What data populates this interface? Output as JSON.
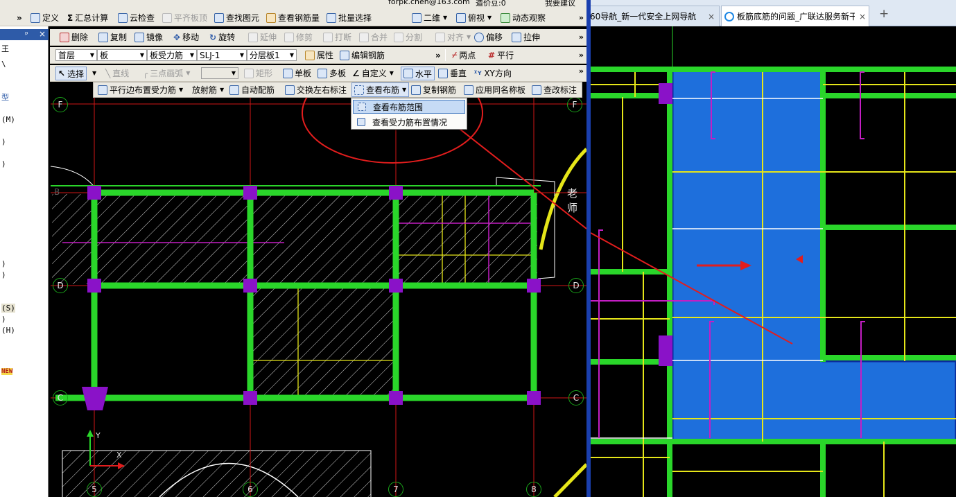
{
  "toolbar1": {
    "overflow_left": "»",
    "define": "定义",
    "sum_calc": "汇总计算",
    "cloud_check": "云检查",
    "align_top": "平齐板顶",
    "find_elem": "查找图元",
    "view_rebar_qty": "查看钢筋量",
    "batch_select": "批量选择",
    "two_d": "二维",
    "top_view": "俯视",
    "dyn_observe": "动态观察",
    "overflow": "»",
    "account": "forpk.chen@163.com",
    "price_bean": "造价豆:0",
    "suggest": "我要建议"
  },
  "left_panel": {
    "pin": "ᵖ",
    "close": "×",
    "rows": [
      "王",
      "\\",
      "型",
      "(M)",
      ")",
      ")",
      ")",
      ")",
      "(S)",
      ")",
      "(H)",
      "NEW"
    ]
  },
  "toolbar2": {
    "delete": "删除",
    "copy": "复制",
    "mirror": "镜像",
    "move": "移动",
    "rotate": "旋转",
    "extend": "延伸",
    "trim": "修剪",
    "break": "打断",
    "merge": "合并",
    "split": "分割",
    "align": "对齐",
    "offset": "偏移",
    "stretch": "拉伸",
    "overflow": "»"
  },
  "toolbar3": {
    "floor": "首层",
    "category": "板",
    "type": "板受力筋",
    "name": "SLJ-1",
    "layer": "分层板1",
    "property": "属性",
    "edit_rebar": "编辑钢筋",
    "overflow": "»",
    "two_points": "两点",
    "parallel": "平行",
    "overflow2": "»"
  },
  "toolbar4": {
    "select": "选择",
    "line": "直线",
    "arc3": "三点画弧",
    "empty_combo": "",
    "rect": "矩形",
    "single_slab": "单板",
    "multi_slab": "多板",
    "custom": "自定义",
    "horizontal": "水平",
    "vertical": "垂直",
    "xy_dir": "XY方向",
    "overflow": "»"
  },
  "toolbar5": {
    "parallel_edge": "平行边布置受力筋",
    "radial": "放射筋",
    "auto_layout": "自动配筋",
    "swap_labels": "交换左右标注",
    "view_layout": "查看布筋",
    "copy_rebar": "复制钢筋",
    "apply_same": "应用同名称板",
    "check_label": "查改标注"
  },
  "dropdown": {
    "items": [
      "查看布筋范围",
      "查看受力筋布置情况"
    ]
  },
  "axes": {
    "left_rows": [
      "F",
      "D",
      "C"
    ],
    "right_rows": [
      "F",
      "D",
      "C"
    ],
    "bottom_cols": [
      "5",
      "6",
      "7",
      "8"
    ],
    "row_b_left": "B"
  },
  "canvas_text": {
    "teacher": "老师",
    "y_axis": "Y",
    "x_axis": "X"
  },
  "browser": {
    "tabs": [
      {
        "label": "60导航_新一代安全上网导航",
        "close": "×"
      },
      {
        "label": "板筋底筋的问题_广联达服务新干",
        "close": "×"
      }
    ],
    "new_tab": "+"
  },
  "colors": {
    "green": "#2ad62a",
    "magenta": "#c41ec4",
    "yellow": "#e6e619",
    "blue": "#1e6fdc",
    "purple": "#8a12c8",
    "red": "#e21d1d"
  }
}
